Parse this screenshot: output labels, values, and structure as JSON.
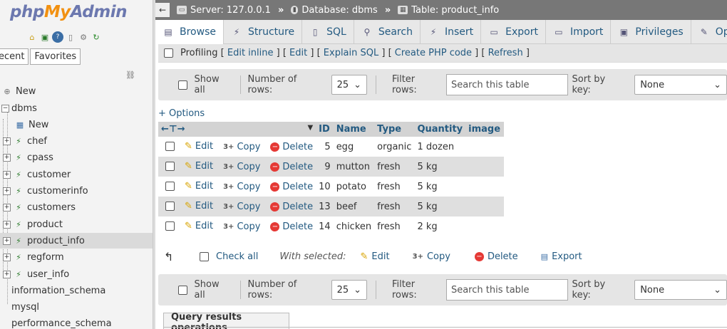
{
  "logo": {
    "php": "php",
    "my": "My",
    "admin": "Admin"
  },
  "nav": {
    "tabs": [
      "ecent",
      "Favorites"
    ],
    "tree": [
      {
        "label": "New",
        "level": 0
      },
      {
        "label": "dbms",
        "level": 0
      },
      {
        "label": "New",
        "level": 1
      },
      {
        "label": "chef",
        "level": 1
      },
      {
        "label": "cpass",
        "level": 1
      },
      {
        "label": "customer",
        "level": 1
      },
      {
        "label": "customerinfo",
        "level": 1
      },
      {
        "label": "customers",
        "level": 1
      },
      {
        "label": "product",
        "level": 1
      },
      {
        "label": "product_info",
        "level": 1,
        "selected": true
      },
      {
        "label": "regform",
        "level": 1
      },
      {
        "label": "user_info",
        "level": 1
      },
      {
        "label": "information_schema",
        "level": 0
      },
      {
        "label": "mysql",
        "level": 0
      },
      {
        "label": "performance_schema",
        "level": 0
      }
    ]
  },
  "breadcrumb": {
    "server": "Server: 127.0.0.1",
    "database": "Database: dbms",
    "table": "Table: product_info",
    "separator": "»"
  },
  "tabs": [
    "Browse",
    "Structure",
    "SQL",
    "Search",
    "Insert",
    "Export",
    "Import",
    "Privileges",
    "Ope"
  ],
  "profiling": {
    "label": "Profiling",
    "links": [
      "Edit inline",
      "Edit",
      "Explain SQL",
      "Create PHP code",
      "Refresh"
    ]
  },
  "navbar": {
    "show_all": "Show all",
    "rows_label": "Number of rows:",
    "rows_value": "25",
    "filter_label": "Filter rows:",
    "filter_placeholder": "Search this table",
    "sort_label": "Sort by key:",
    "sort_value": "None"
  },
  "options_label": "+ Options",
  "table": {
    "columns": [
      "ID",
      "Name",
      "Type",
      "Quantity",
      "image"
    ],
    "actions": {
      "edit": "Edit",
      "copy": "Copy",
      "delete": "Delete"
    },
    "rows": [
      {
        "id": "5",
        "name": "egg",
        "type": "organic",
        "quantity": "1 dozen",
        "image": ""
      },
      {
        "id": "9",
        "name": "mutton",
        "type": "fresh",
        "quantity": "5 kg",
        "image": ""
      },
      {
        "id": "10",
        "name": "potato",
        "type": "fresh",
        "quantity": "5 kg",
        "image": ""
      },
      {
        "id": "13",
        "name": "beef",
        "type": "fresh",
        "quantity": "5 kg",
        "image": ""
      },
      {
        "id": "14",
        "name": "chicken",
        "type": "fresh",
        "quantity": "2 kg",
        "image": ""
      }
    ]
  },
  "with_selected": {
    "check_all": "Check all",
    "label": "With selected:",
    "edit": "Edit",
    "copy": "Copy",
    "delete": "Delete",
    "export": "Export"
  },
  "query_ops": "Query results operations"
}
